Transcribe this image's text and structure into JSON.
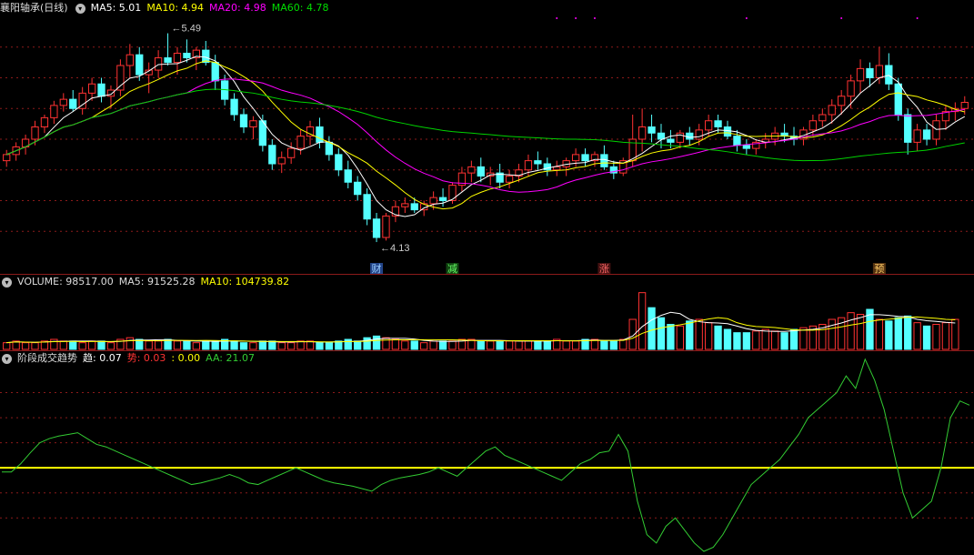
{
  "main_header": {
    "stock": "襄阳轴承(日线)",
    "ma5": "MA5: 5.01",
    "ma10": "MA10: 4.94",
    "ma20": "MA20: 4.98",
    "ma60": "MA60: 4.78"
  },
  "vol_header": {
    "volume": "VOLUME: 98517.00",
    "ma5": "MA5: 91525.28",
    "ma10": "MA10: 104739.82"
  },
  "ind_header": {
    "name": "阶段成交趋势",
    "qu": "趋: 0.07",
    "shi": "势: 0.03",
    "blank": ": 0.00",
    "aa": "AA: 21.07"
  },
  "annotations": {
    "high": "5.49",
    "low": "4.13",
    "events": [
      "财",
      "减",
      "涨",
      "预"
    ]
  },
  "colors": {
    "up": "#ff3232",
    "down": "#54ffff",
    "ma5": "#ffffff",
    "ma10": "#ffff00",
    "ma20": "#ff00ff",
    "ma60": "#00d200",
    "aa": "#33cc33",
    "grid": "#8b1a1a"
  },
  "chart_data": [
    {
      "type": "candlestick",
      "title": "襄阳轴承(日线)",
      "ylim": [
        4.0,
        5.6
      ],
      "high": 5.49,
      "low": 4.13,
      "ohlc": [
        [
          4.66,
          4.73,
          4.62,
          4.7
        ],
        [
          4.7,
          4.78,
          4.66,
          4.75
        ],
        [
          4.75,
          4.83,
          4.7,
          4.8
        ],
        [
          4.8,
          4.92,
          4.76,
          4.88
        ],
        [
          4.88,
          4.96,
          4.84,
          4.94
        ],
        [
          4.94,
          5.05,
          4.9,
          5.02
        ],
        [
          5.02,
          5.1,
          4.98,
          5.06
        ],
        [
          5.06,
          5.12,
          4.98,
          5.0
        ],
        [
          5.0,
          5.14,
          4.96,
          5.1
        ],
        [
          5.1,
          5.2,
          5.05,
          5.16
        ],
        [
          5.16,
          5.2,
          5.04,
          5.08
        ],
        [
          5.08,
          5.15,
          5.0,
          5.12
        ],
        [
          5.12,
          5.32,
          5.08,
          5.28
        ],
        [
          5.28,
          5.42,
          5.2,
          5.35
        ],
        [
          5.35,
          5.4,
          5.18,
          5.22
        ],
        [
          5.22,
          5.3,
          5.1,
          5.25
        ],
        [
          5.25,
          5.38,
          5.2,
          5.33
        ],
        [
          5.33,
          5.49,
          5.28,
          5.3
        ],
        [
          5.3,
          5.4,
          5.22,
          5.36
        ],
        [
          5.36,
          5.45,
          5.3,
          5.33
        ],
        [
          5.33,
          5.4,
          5.25,
          5.38
        ],
        [
          5.38,
          5.44,
          5.28,
          5.3
        ],
        [
          5.3,
          5.35,
          5.12,
          5.18
        ],
        [
          5.18,
          5.22,
          5.02,
          5.06
        ],
        [
          5.06,
          5.1,
          4.92,
          4.96
        ],
        [
          4.96,
          5.0,
          4.84,
          4.88
        ],
        [
          4.88,
          4.95,
          4.8,
          4.92
        ],
        [
          4.92,
          4.96,
          4.72,
          4.76
        ],
        [
          4.76,
          4.8,
          4.6,
          4.64
        ],
        [
          4.64,
          4.72,
          4.58,
          4.68
        ],
        [
          4.68,
          4.78,
          4.64,
          4.74
        ],
        [
          4.74,
          4.86,
          4.7,
          4.82
        ],
        [
          4.82,
          4.92,
          4.76,
          4.88
        ],
        [
          4.88,
          4.94,
          4.74,
          4.78
        ],
        [
          4.78,
          4.82,
          4.66,
          4.7
        ],
        [
          4.7,
          4.74,
          4.56,
          4.6
        ],
        [
          4.6,
          4.66,
          4.48,
          4.52
        ],
        [
          4.52,
          4.56,
          4.4,
          4.44
        ],
        [
          4.44,
          4.48,
          4.24,
          4.28
        ],
        [
          4.28,
          4.32,
          4.13,
          4.16
        ],
        [
          4.16,
          4.32,
          4.14,
          4.3
        ],
        [
          4.3,
          4.4,
          4.26,
          4.36
        ],
        [
          4.36,
          4.42,
          4.32,
          4.38
        ],
        [
          4.38,
          4.42,
          4.32,
          4.34
        ],
        [
          4.34,
          4.4,
          4.3,
          4.38
        ],
        [
          4.38,
          4.46,
          4.34,
          4.42
        ],
        [
          4.42,
          4.48,
          4.36,
          4.4
        ],
        [
          4.4,
          4.52,
          4.38,
          4.5
        ],
        [
          4.5,
          4.62,
          4.46,
          4.58
        ],
        [
          4.58,
          4.66,
          4.52,
          4.62
        ],
        [
          4.62,
          4.68,
          4.52,
          4.56
        ],
        [
          4.56,
          4.62,
          4.5,
          4.58
        ],
        [
          4.58,
          4.64,
          4.48,
          4.52
        ],
        [
          4.52,
          4.6,
          4.48,
          4.56
        ],
        [
          4.56,
          4.64,
          4.52,
          4.6
        ],
        [
          4.6,
          4.7,
          4.56,
          4.66
        ],
        [
          4.66,
          4.72,
          4.6,
          4.64
        ],
        [
          4.64,
          4.68,
          4.56,
          4.6
        ],
        [
          4.6,
          4.66,
          4.56,
          4.62
        ],
        [
          4.62,
          4.68,
          4.56,
          4.66
        ],
        [
          4.66,
          4.74,
          4.62,
          4.7
        ],
        [
          4.7,
          4.74,
          4.62,
          4.66
        ],
        [
          4.66,
          4.72,
          4.62,
          4.7
        ],
        [
          4.7,
          4.76,
          4.6,
          4.62
        ],
        [
          4.62,
          4.66,
          4.54,
          4.58
        ],
        [
          4.58,
          4.68,
          4.56,
          4.66
        ],
        [
          4.66,
          4.96,
          4.62,
          4.8
        ],
        [
          4.8,
          5.0,
          4.72,
          4.88
        ],
        [
          4.88,
          4.96,
          4.78,
          4.84
        ],
        [
          4.84,
          4.9,
          4.74,
          4.8
        ],
        [
          4.8,
          4.86,
          4.74,
          4.78
        ],
        [
          4.78,
          4.86,
          4.74,
          4.84
        ],
        [
          4.84,
          4.88,
          4.76,
          4.8
        ],
        [
          4.8,
          4.9,
          4.76,
          4.86
        ],
        [
          4.86,
          4.96,
          4.82,
          4.92
        ],
        [
          4.92,
          4.96,
          4.84,
          4.88
        ],
        [
          4.88,
          4.92,
          4.8,
          4.82
        ],
        [
          4.82,
          4.86,
          4.72,
          4.76
        ],
        [
          4.76,
          4.8,
          4.7,
          4.74
        ],
        [
          4.74,
          4.8,
          4.7,
          4.78
        ],
        [
          4.78,
          4.84,
          4.74,
          4.8
        ],
        [
          4.8,
          4.88,
          4.76,
          4.84
        ],
        [
          4.84,
          4.9,
          4.78,
          4.82
        ],
        [
          4.82,
          4.88,
          4.76,
          4.8
        ],
        [
          4.8,
          4.88,
          4.76,
          4.86
        ],
        [
          4.86,
          4.96,
          4.82,
          4.92
        ],
        [
          4.92,
          5.0,
          4.88,
          4.96
        ],
        [
          4.96,
          5.06,
          4.9,
          5.02
        ],
        [
          5.02,
          5.12,
          4.96,
          5.08
        ],
        [
          5.08,
          5.22,
          5.0,
          5.18
        ],
        [
          5.18,
          5.32,
          5.1,
          5.26
        ],
        [
          5.26,
          5.3,
          5.14,
          5.2
        ],
        [
          5.2,
          5.4,
          5.16,
          5.28
        ],
        [
          5.28,
          5.36,
          5.12,
          5.16
        ],
        [
          5.16,
          5.2,
          4.92,
          4.96
        ],
        [
          4.96,
          5.0,
          4.7,
          4.78
        ],
        [
          4.78,
          4.9,
          4.72,
          4.86
        ],
        [
          4.86,
          4.9,
          4.76,
          4.8
        ],
        [
          4.8,
          4.96,
          4.76,
          4.92
        ],
        [
          4.92,
          5.02,
          4.86,
          4.98
        ],
        [
          4.98,
          5.04,
          4.92,
          5.0
        ],
        [
          5.0,
          5.08,
          4.96,
          5.04
        ]
      ],
      "volume": [
        4,
        5,
        4,
        4,
        5,
        6,
        5,
        5,
        4,
        5,
        5,
        4,
        6,
        7,
        6,
        5,
        5,
        6,
        5,
        5,
        4,
        5,
        5,
        6,
        5,
        4,
        4,
        5,
        5,
        4,
        4,
        5,
        5,
        4,
        4,
        5,
        6,
        5,
        7,
        8,
        7,
        6,
        5,
        5,
        4,
        5,
        5,
        5,
        6,
        6,
        5,
        5,
        5,
        5,
        5,
        5,
        5,
        5,
        6,
        5,
        5,
        6,
        6,
        5,
        5,
        6,
        18,
        34,
        25,
        19,
        15,
        14,
        17,
        18,
        16,
        14,
        12,
        10,
        10,
        11,
        12,
        11,
        10,
        12,
        13,
        14,
        15,
        18,
        19,
        22,
        21,
        24,
        18,
        17,
        19,
        20,
        16,
        14,
        15,
        16,
        18
      ],
      "indicator": {
        "name": "阶段成交趋势",
        "qu": 0.07,
        "shi": 0.03,
        "aa": 21.07,
        "ylim": [
          -100,
          120
        ],
        "aa_values": [
          -5,
          -5,
          5,
          18,
          30,
          35,
          38,
          40,
          42,
          35,
          28,
          25,
          20,
          15,
          10,
          5,
          0,
          -5,
          -10,
          -15,
          -20,
          -18,
          -15,
          -12,
          -8,
          -12,
          -18,
          -20,
          -15,
          -10,
          -5,
          0,
          -5,
          -10,
          -15,
          -18,
          -20,
          -22,
          -25,
          -28,
          -20,
          -15,
          -12,
          -10,
          -8,
          -5,
          0,
          -5,
          -10,
          0,
          10,
          20,
          25,
          15,
          10,
          5,
          0,
          -5,
          -10,
          -15,
          -5,
          5,
          10,
          18,
          20,
          40,
          20,
          -40,
          -80,
          -90,
          -70,
          -60,
          -75,
          -90,
          -100,
          -95,
          -80,
          -60,
          -40,
          -20,
          -10,
          0,
          10,
          25,
          40,
          60,
          70,
          80,
          90,
          110,
          95,
          130,
          105,
          70,
          20,
          -30,
          -60,
          -50,
          -40,
          0,
          60,
          80,
          75
        ]
      },
      "events": [
        "财",
        "减",
        "涨",
        "预"
      ]
    }
  ]
}
